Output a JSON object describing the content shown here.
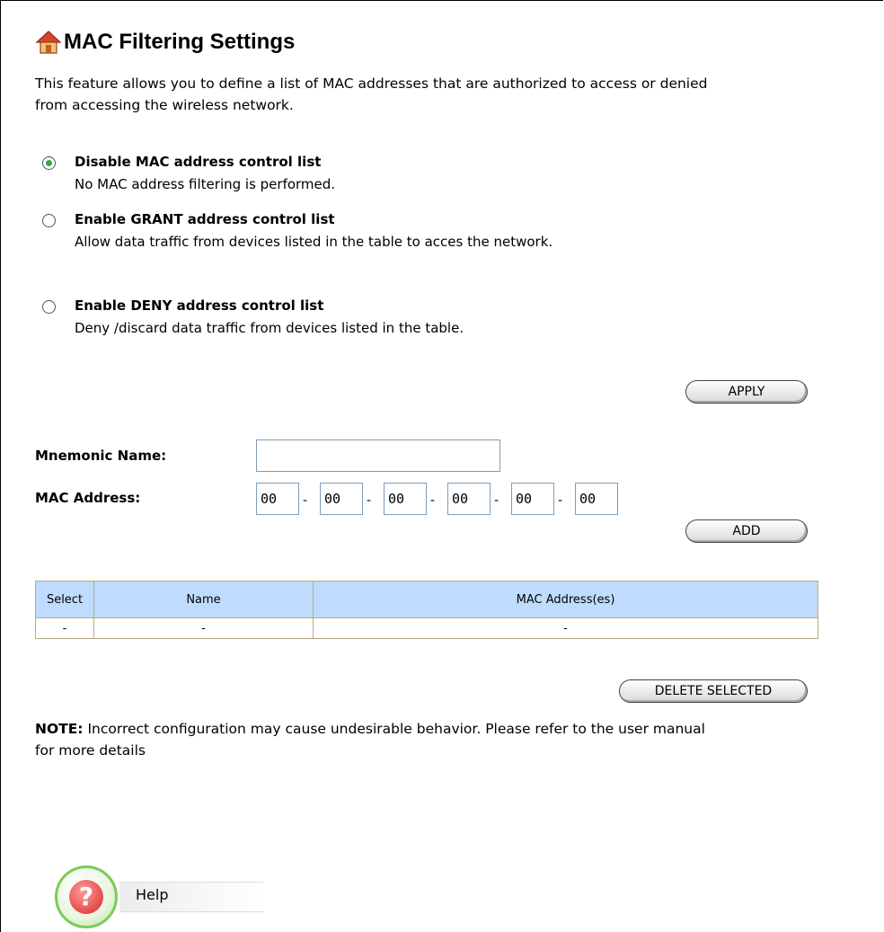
{
  "page": {
    "title": "MAC Filtering Settings",
    "intro_line1": "This feature allows you to define a list of MAC addresses that are authorized to access or denied",
    "intro_line2": "from accessing the wireless network."
  },
  "options": [
    {
      "label": "Disable MAC address control list",
      "desc": "No MAC address filtering is performed.",
      "checked": true
    },
    {
      "label": "Enable GRANT address control list",
      "desc": "Allow data traffic from devices listed in the table to acces the network.",
      "checked": false
    },
    {
      "label": "Enable DENY address control list",
      "desc": "Deny /discard data traffic from devices listed in the table.",
      "checked": false
    }
  ],
  "buttons": {
    "apply": "APPLY",
    "add": "ADD",
    "delete_selected": "DELETE SELECTED"
  },
  "form": {
    "mnemonic_label": "Mnemonic Name:",
    "mnemonic_value": "",
    "mac_label": "MAC Address:",
    "mac_octets": [
      "00",
      "00",
      "00",
      "00",
      "00",
      "00"
    ],
    "separator": "-"
  },
  "table": {
    "headers": [
      "Select",
      "Name",
      "MAC Address(es)"
    ],
    "rows": [
      [
        "-",
        "-",
        "-"
      ]
    ]
  },
  "note": {
    "bold": "NOTE:",
    "text_line1": " Incorrect configuration may cause undesirable behavior. Please refer to the user manual",
    "text_line2": "for more details"
  },
  "help": {
    "label": "Help"
  },
  "colors": {
    "table_header_bg": "#bfdcff",
    "radio_checked": "#3aa838",
    "help_ring": "#7ccb57",
    "help_question": "#d72a2a"
  },
  "icons": {
    "title_icon": "home-icon",
    "help_icon": "help-question-icon"
  }
}
